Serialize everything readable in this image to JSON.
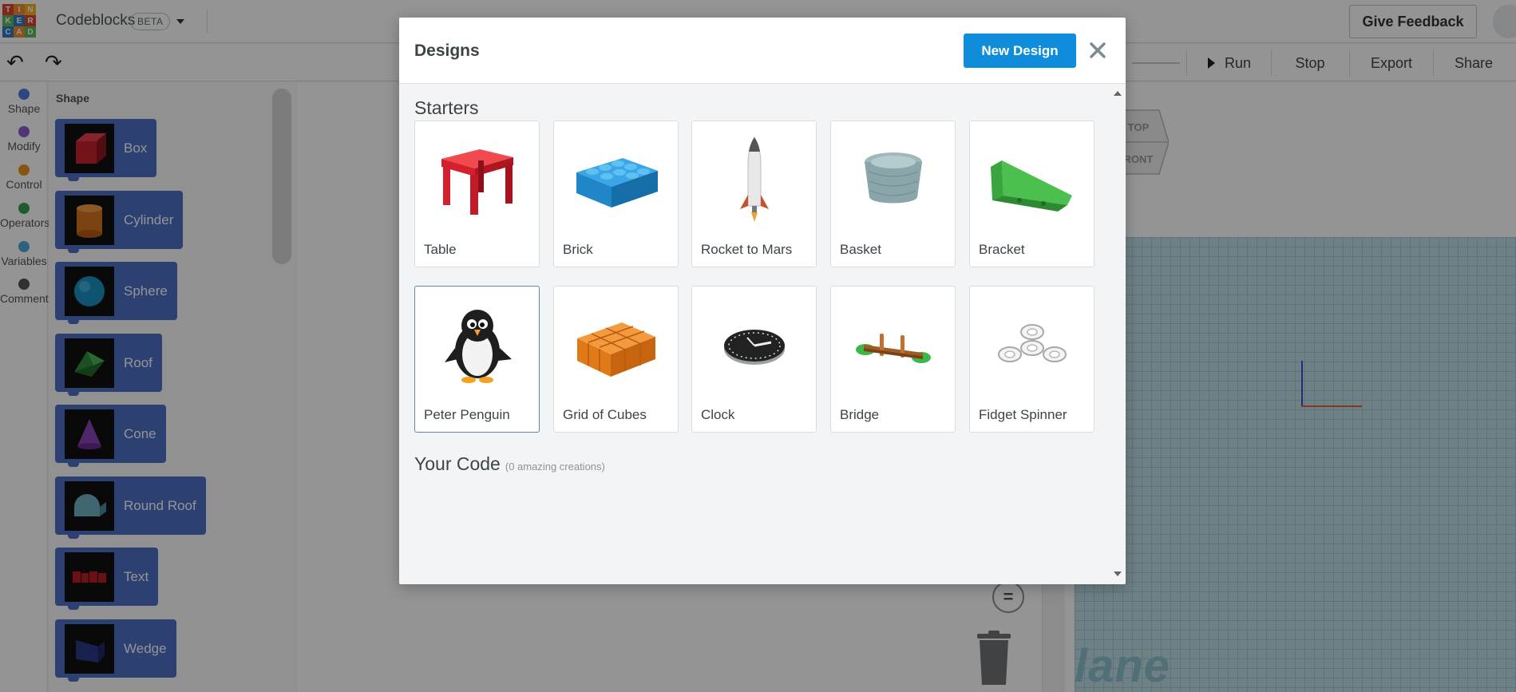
{
  "header": {
    "logo_letters": [
      "T",
      "I",
      "N",
      "K",
      "E",
      "R",
      "C",
      "A",
      "D"
    ],
    "logo_colors": [
      "#e2402f",
      "#f28b2b",
      "#f6b219",
      "#5cb85c",
      "#2f7ac8",
      "#e2402f",
      "#2f7ac8",
      "#f28b2b",
      "#5cb85c"
    ],
    "app_title": "Codeblocks",
    "beta_badge": "BETA",
    "feedback_label": "Give Feedback"
  },
  "toolbar": {
    "run_label": "Run",
    "stop_label": "Stop",
    "export_label": "Export",
    "share_label": "Share"
  },
  "categories": [
    {
      "label": "Shape",
      "color": "#4c7be0"
    },
    {
      "label": "Modify",
      "color": "#8a5cd0"
    },
    {
      "label": "Control",
      "color": "#e8951c"
    },
    {
      "label": "Operators",
      "color": "#3aa14a"
    },
    {
      "label": "Variables",
      "color": "#4fa7d8"
    },
    {
      "label": "Comment",
      "color": "#555555"
    }
  ],
  "flyout": {
    "title": "Shape",
    "blocks": [
      {
        "label": "Box",
        "icon": "red-box-icon"
      },
      {
        "label": "Cylinder",
        "icon": "orange-cylinder-icon"
      },
      {
        "label": "Sphere",
        "icon": "blue-sphere-icon"
      },
      {
        "label": "Roof",
        "icon": "green-roof-icon"
      },
      {
        "label": "Cone",
        "icon": "purple-cone-icon"
      },
      {
        "label": "Round Roof",
        "icon": "teal-round-roof-icon"
      },
      {
        "label": "Text",
        "icon": "red-text-icon"
      },
      {
        "label": "Wedge",
        "icon": "navy-wedge-icon"
      }
    ]
  },
  "viewport": {
    "viewcube_top": "TOP",
    "viewcube_front": "FRONT",
    "plane_label": "lane"
  },
  "workspace": {
    "zoom_symbol": "="
  },
  "modal": {
    "title": "Designs",
    "new_design_label": "New Design",
    "starters_title": "Starters",
    "your_code_title": "Your Code",
    "your_code_sub": "(0 amazing creations)",
    "starters": [
      {
        "label": "Table",
        "icon": "table-icon"
      },
      {
        "label": "Brick",
        "icon": "brick-icon"
      },
      {
        "label": "Rocket to Mars",
        "icon": "rocket-icon"
      },
      {
        "label": "Basket",
        "icon": "basket-icon"
      },
      {
        "label": "Bracket",
        "icon": "bracket-icon"
      },
      {
        "label": "Peter Penguin",
        "icon": "penguin-icon"
      },
      {
        "label": "Grid of Cubes",
        "icon": "grid-cubes-icon"
      },
      {
        "label": "Clock",
        "icon": "clock-icon"
      },
      {
        "label": "Bridge",
        "icon": "bridge-icon"
      },
      {
        "label": "Fidget Spinner",
        "icon": "fidget-spinner-icon"
      }
    ]
  }
}
